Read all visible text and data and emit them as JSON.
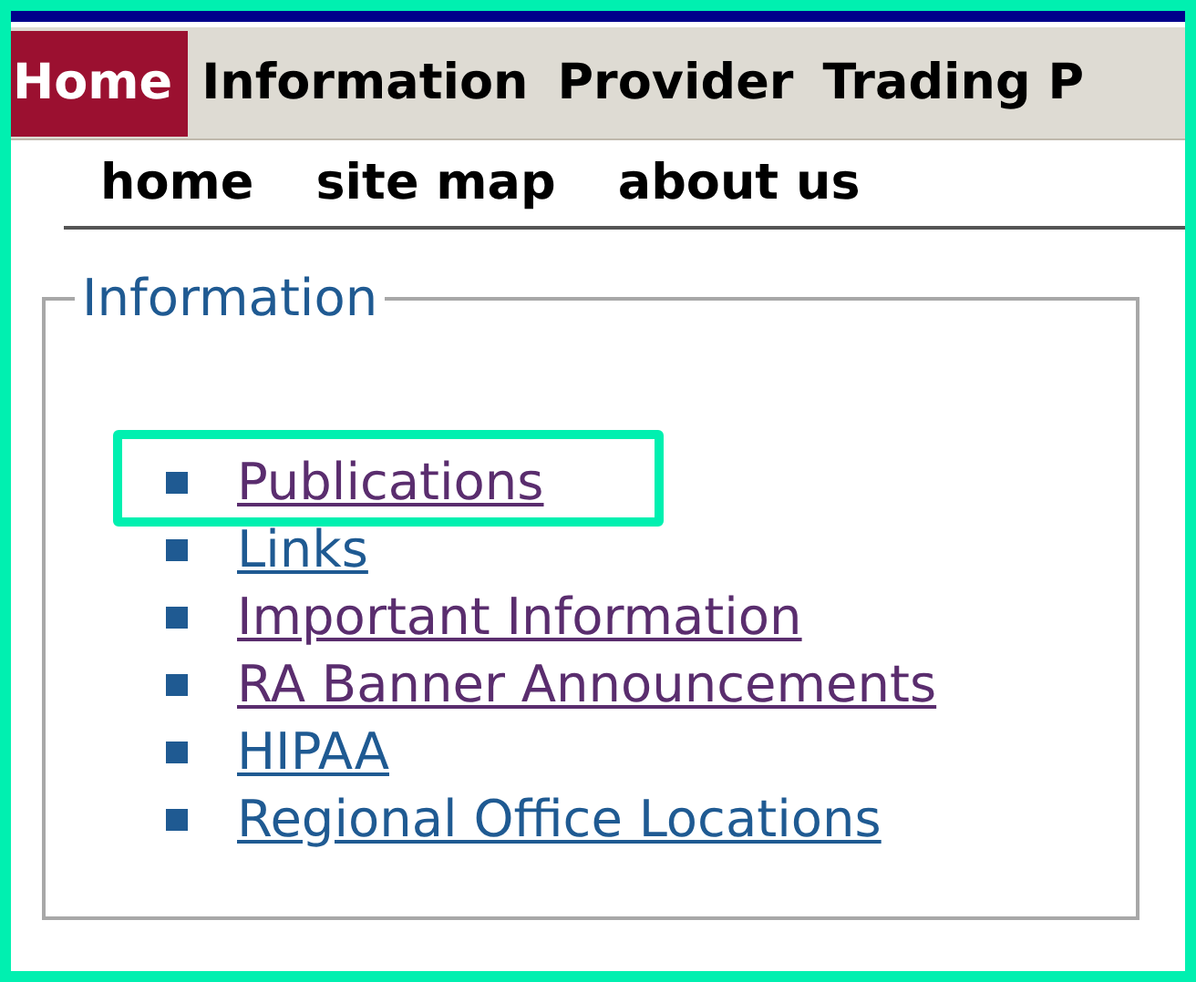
{
  "main_nav": [
    {
      "label": "Home",
      "selected": true
    },
    {
      "label": "Information",
      "selected": false
    },
    {
      "label": "Provider",
      "selected": false
    },
    {
      "label": "Trading P",
      "selected": false
    }
  ],
  "sub_nav": [
    "home",
    "site map",
    "about us"
  ],
  "panel": {
    "legend": "Information",
    "links": [
      {
        "label": "Publications",
        "visited": true,
        "highlighted": true
      },
      {
        "label": "Links",
        "visited": false,
        "highlighted": false
      },
      {
        "label": "Important Information",
        "visited": true,
        "highlighted": false
      },
      {
        "label": "RA Banner Announcements",
        "visited": true,
        "highlighted": false
      },
      {
        "label": "HIPAA",
        "visited": false,
        "highlighted": false
      },
      {
        "label": "Regional Office Locations",
        "visited": false,
        "highlighted": false
      }
    ]
  }
}
